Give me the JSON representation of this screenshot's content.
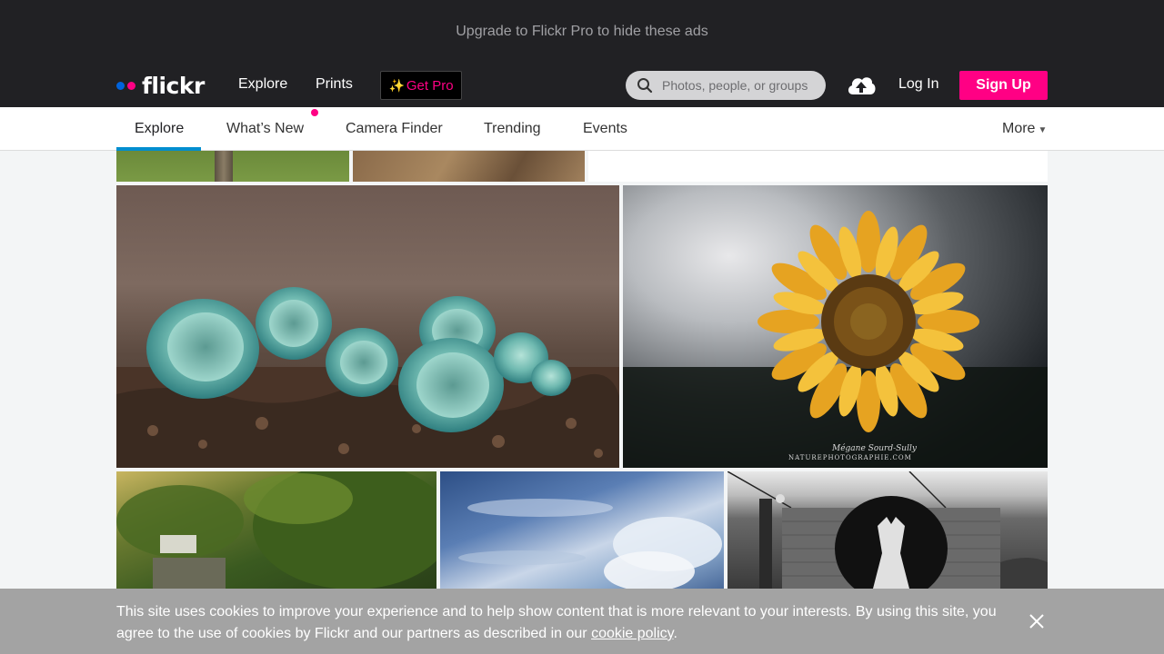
{
  "ad": {
    "text": "Upgrade to Flickr Pro to hide these ads"
  },
  "header": {
    "logo_text": "flickr",
    "nav": {
      "explore": "Explore",
      "prints": "Prints"
    },
    "get_pro": {
      "icon": "sparkles-icon",
      "label": "Get Pro"
    },
    "search": {
      "placeholder": "Photos, people, or groups"
    },
    "upload_icon": "cloud-upload-icon",
    "login_label": "Log In",
    "signup_label": "Sign Up"
  },
  "subnav": {
    "tabs": [
      {
        "label": "Explore",
        "active": true
      },
      {
        "label": "What’s New",
        "badge": true
      },
      {
        "label": "Camera Finder"
      },
      {
        "label": "Trending"
      },
      {
        "label": "Events"
      }
    ],
    "more_label": "More"
  },
  "photos": [
    {
      "name": "tree-trunk-partial"
    },
    {
      "name": "mountain-partial"
    },
    {
      "name": "white-partial"
    },
    {
      "name": "blue-green-elf-cup-fungi"
    },
    {
      "name": "sunflower"
    },
    {
      "name": "green-hedge-lane"
    },
    {
      "name": "cloudy-sky"
    },
    {
      "name": "statue-of-liberty-graffiti"
    }
  ],
  "sunflower_watermark": {
    "signature": "Mégane Sourd-Sully",
    "site": "NATUREPHOTOGRAPHIE.COM"
  },
  "cookie_banner": {
    "text": "This site uses cookies to improve your experience and to help show content that is more relevant to your interests. By using this site, you agree to the use of cookies by Flickr and our partners as described in our ",
    "link_text": "cookie policy",
    "end": ".",
    "close_icon": "close-icon"
  },
  "colors": {
    "brand_blue": "#0063dc",
    "brand_pink": "#ff0084",
    "active_tab": "#008ecf",
    "header_bg": "#212124"
  }
}
